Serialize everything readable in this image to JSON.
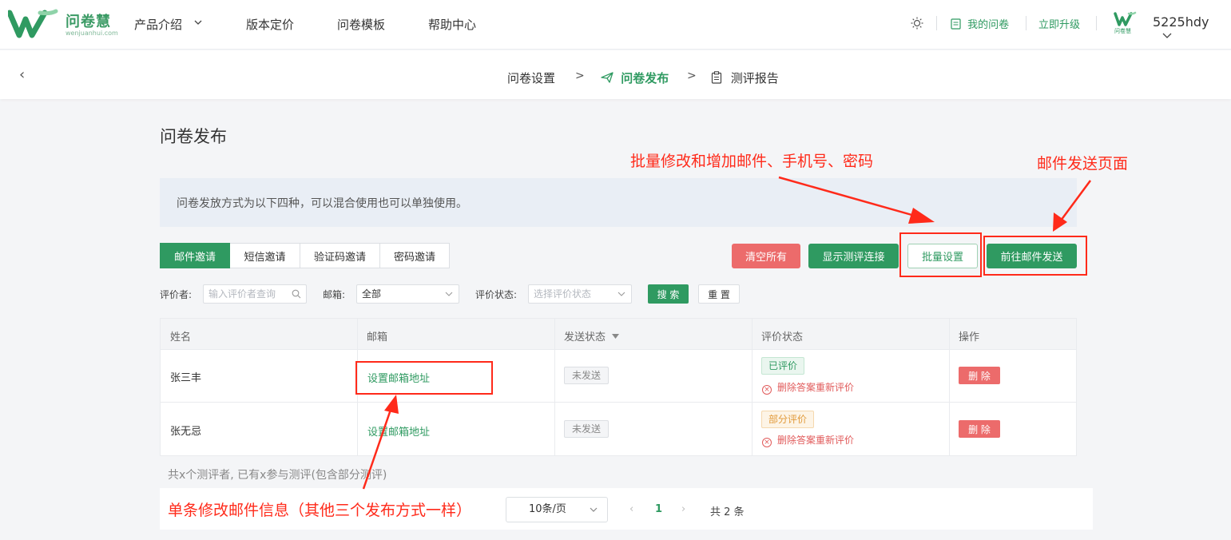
{
  "brand": {
    "name": "问卷慧",
    "url": "wenjuanhui.com",
    "accent": "#2f9a61"
  },
  "nav": {
    "items": [
      "产品介绍",
      "版本定价",
      "问卷模板",
      "帮助中心"
    ],
    "my_survey": "我的问卷",
    "upgrade": "立即升级",
    "avatar_text": "问卷慧",
    "username": "5225hdy"
  },
  "steps": {
    "back": "‹",
    "items": [
      "问卷设置",
      "问卷发布",
      "测评报告"
    ],
    "sep": ">",
    "active_index": 1
  },
  "page": {
    "title": "问卷发布",
    "info": "问卷发放方式为以下四种，可以混合使用也可以单独使用。"
  },
  "tabs": [
    "邮件邀请",
    "短信邀请",
    "验证码邀请",
    "密码邀请"
  ],
  "actions": {
    "clear_all": "清空所有",
    "show_link": "显示测评连接",
    "batch_settings": "批量设置",
    "go_email": "前往邮件发送"
  },
  "filters": {
    "evaluator_label": "评价者:",
    "evaluator_placeholder": "输入评价者查询",
    "email_label": "邮箱:",
    "email_value": "全部",
    "status_label": "评价状态:",
    "status_placeholder": "选择评价状态",
    "search": "搜 索",
    "reset": "重 置"
  },
  "table": {
    "headers": [
      "姓名",
      "邮箱",
      "发送状态",
      "评价状态",
      "操作"
    ],
    "rows": [
      {
        "name": "张三丰",
        "email": "设置邮箱地址",
        "send_status": "未发送",
        "eval_status": "已评价",
        "eval_kind": "done",
        "redo": "删除答案重新评价",
        "action": "删 除"
      },
      {
        "name": "张无忌",
        "email": "设置邮箱地址",
        "send_status": "未发送",
        "eval_status": "部分评价",
        "eval_kind": "partial",
        "redo": "删除答案重新评价",
        "action": "删 除"
      }
    ]
  },
  "summary": "共x个测评者, 已有x参与测评(包含部分测评)",
  "pagination": {
    "page_size": "10条/页",
    "prev": "‹",
    "current": "1",
    "next": "›",
    "total": "共 2 条"
  },
  "annotations": {
    "batch": "批量修改和增加邮件、手机号、密码",
    "email_page": "邮件发送页面",
    "single": "单条修改邮件信息（其他三个发布方式一样）",
    "color": "#ff2a1a"
  }
}
